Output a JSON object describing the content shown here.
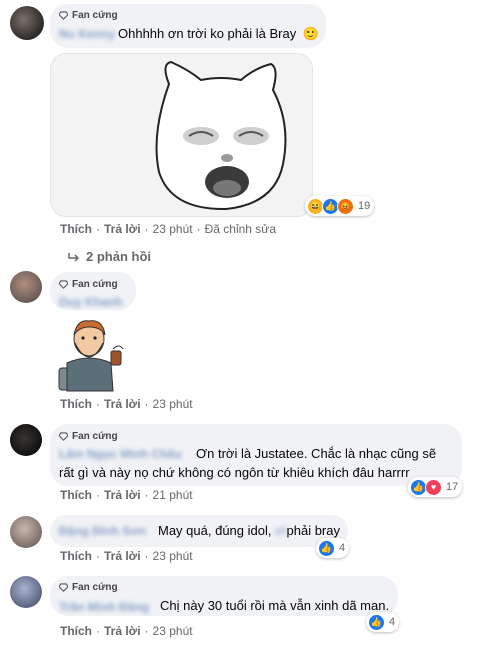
{
  "comments": [
    {
      "badge": "Fan cứng",
      "name": "Nu Kenny",
      "text": "Ohhhhh ơn trời ko phải là Bray",
      "emoji": "🙂",
      "reactions_count": "19",
      "actions": {
        "like": "Thích",
        "reply": "Trả lời",
        "time": "23 phút",
        "edited": "Đã chỉnh sửa"
      },
      "replies": "2 phản hồi"
    },
    {
      "badge": "Fan cứng",
      "name": "Duy Khanh",
      "actions": {
        "like": "Thích",
        "reply": "Trả lời",
        "time": "23 phút"
      }
    },
    {
      "badge": "Fan cứng",
      "name": "Lâm Ngọc Minh Châu",
      "text_line1": "Ơn trời là Justatee. Chắc là nhạc cũng sẽ",
      "text_line2": "rất gì và này nọ chứ không có ngôn từ khiêu khích đâu harrrr",
      "reactions_count": "17",
      "actions": {
        "like": "Thích",
        "reply": "Trả lời",
        "time": "21 phút"
      }
    },
    {
      "name": "Đặng Đình Sơn",
      "text": "May quá, đúng idol, ",
      "text_blur": "ơi",
      "text_end": "phải bray",
      "reactions_count": "4",
      "actions": {
        "like": "Thích",
        "reply": "Trả lời",
        "time": "23 phút"
      }
    },
    {
      "badge": "Fan cứng",
      "name": "Trần Minh Đăng",
      "text": "Chị này 30 tuổi rồi mà vẫn xinh dã man.",
      "reactions_count": "4",
      "actions": {
        "like": "Thích",
        "reply": "Trả lời",
        "time": "23 phút"
      }
    }
  ],
  "colors": {
    "like_blue": "#1877f2",
    "love_red": "#f33e58",
    "haha_yellow": "#f7b125",
    "bubble": "#f0f2f5",
    "meta": "#65676b"
  }
}
